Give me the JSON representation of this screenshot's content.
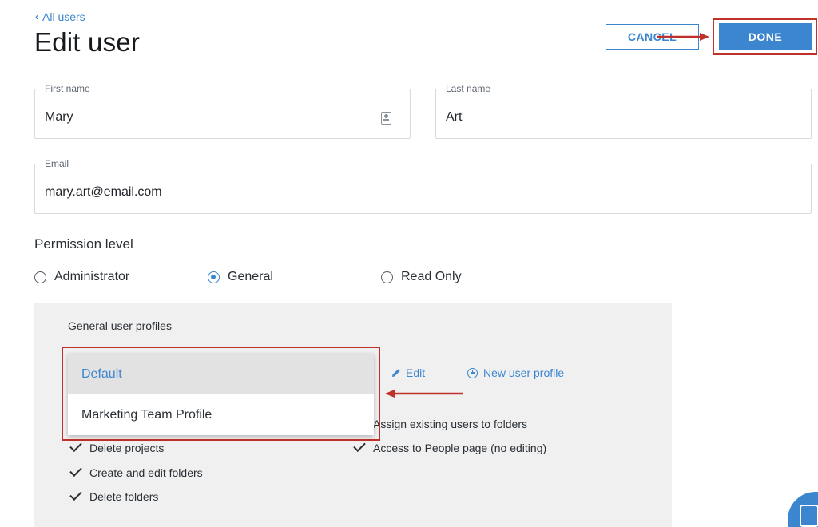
{
  "nav": {
    "back_label": "All users"
  },
  "header": {
    "title": "Edit user",
    "cancel_label": "CANCEL",
    "done_label": "DONE"
  },
  "form": {
    "first_name": {
      "label": "First name",
      "value": "Mary"
    },
    "last_name": {
      "label": "Last name",
      "value": "Art"
    },
    "email": {
      "label": "Email",
      "value": "mary.art@email.com"
    }
  },
  "permission": {
    "label": "Permission level",
    "options": [
      {
        "label": "Administrator",
        "checked": false
      },
      {
        "label": "General",
        "checked": true
      },
      {
        "label": "Read Only",
        "checked": false
      }
    ]
  },
  "profiles": {
    "label": "General user profiles",
    "dropdown_options": [
      "Default",
      "Marketing Team Profile"
    ],
    "selected": "Default",
    "edit_label": "Edit",
    "new_profile_label": "New user profile",
    "permissions_left": [
      "Delete projects",
      "Create and edit folders",
      "Delete folders"
    ],
    "permissions_right": [
      "Assign existing users to folders",
      "Access to People page (no editing)"
    ]
  },
  "colors": {
    "accent": "#3b86cf",
    "annotation": "#c0312b",
    "panel": "#f0f0f0"
  },
  "icons": {
    "back": "chevron-left-icon",
    "contact": "contact-card-icon",
    "radio": "radio-icon",
    "edit": "pencil-icon",
    "new_profile": "plus-circle-icon",
    "check": "checkmark-icon",
    "chat": "chat-icon"
  }
}
